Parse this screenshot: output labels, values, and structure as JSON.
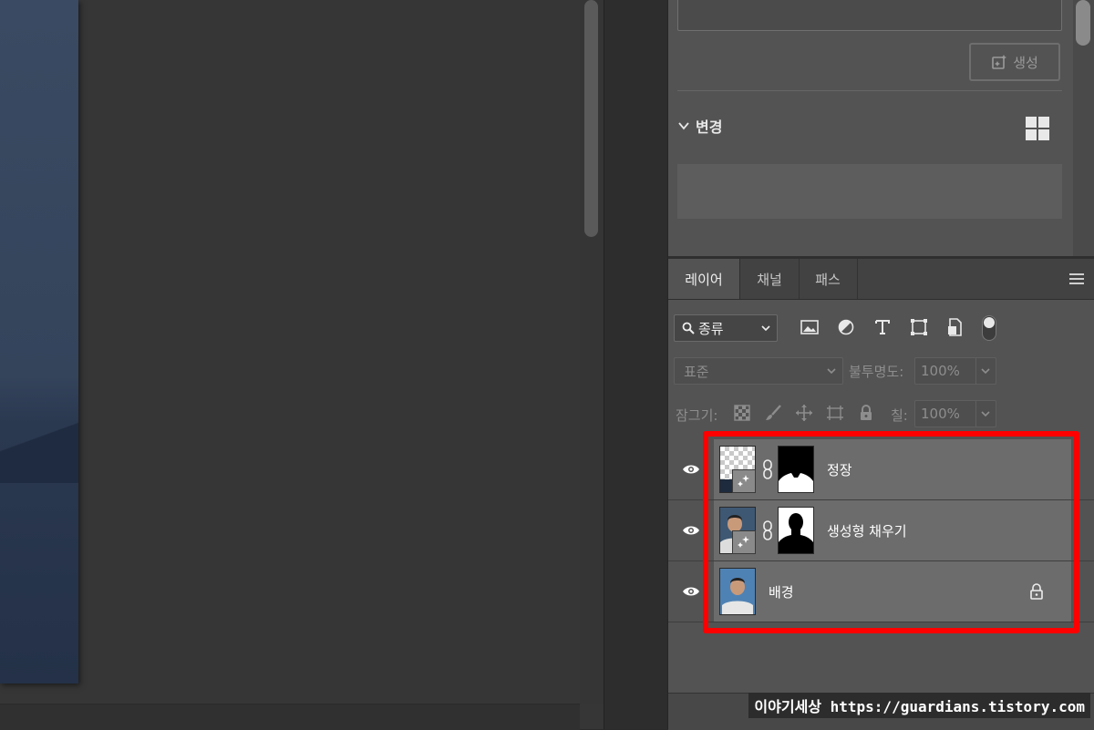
{
  "generative_panel": {
    "generate_button_label": "생성",
    "variations_header": "변경"
  },
  "layers_panel": {
    "tabs": [
      {
        "label": "레이어",
        "active": true
      },
      {
        "label": "채널",
        "active": false
      },
      {
        "label": "패스",
        "active": false
      }
    ],
    "filter": {
      "kind_label": "종류",
      "filter_icons": [
        "image-filter-icon",
        "adjustment-filter-icon",
        "type-filter-icon",
        "shape-filter-icon",
        "smart-object-filter-icon"
      ]
    },
    "blend_mode": "표준",
    "opacity_label": "불투명도:",
    "opacity_value": "100%",
    "lock_label": "잠그기:",
    "fill_label": "칠:",
    "fill_value": "100%",
    "layers": [
      {
        "name": "정장",
        "visible": true,
        "type": "generative-fill-with-mask"
      },
      {
        "name": "생성형 채우기",
        "visible": true,
        "type": "generative-fill-with-mask"
      },
      {
        "name": "배경",
        "visible": true,
        "type": "background",
        "locked": true
      }
    ],
    "highlight_color": "#ff0000"
  },
  "watermark": "이야기세상 https://guardians.tistory.com",
  "colors": {
    "panel_bg": "#535353",
    "canvas_bg": "#363636",
    "layer_row_bg": "#6c6c6c",
    "highlight": "#ff0000"
  }
}
